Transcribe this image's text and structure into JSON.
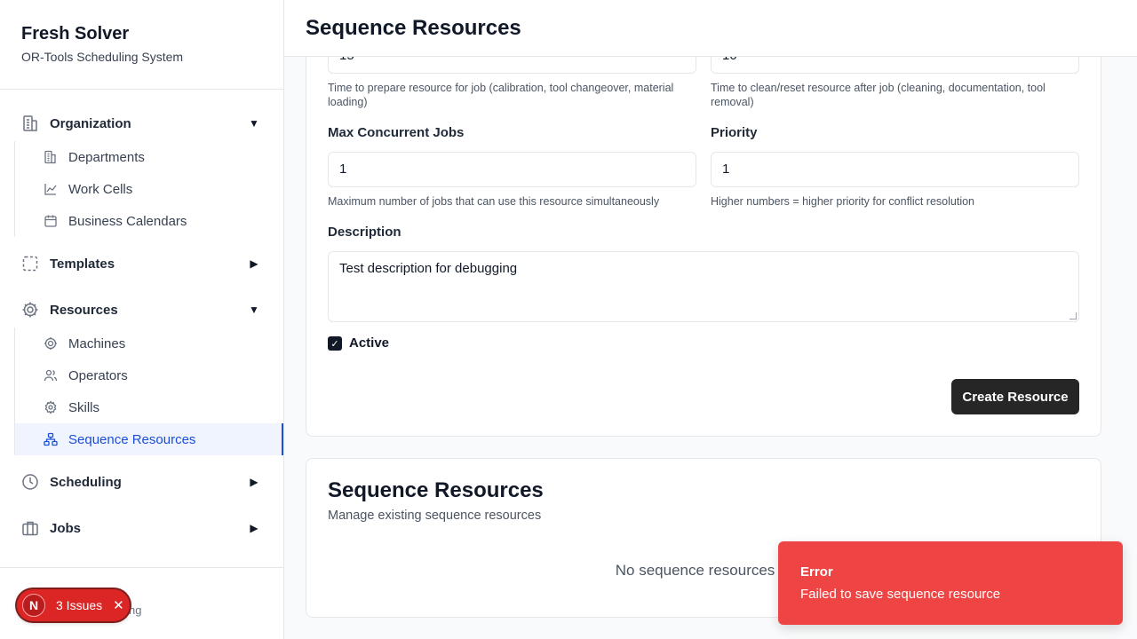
{
  "sidebar": {
    "title": "Fresh Solver",
    "subtitle": "OR-Tools Scheduling System",
    "groups": [
      {
        "label": "Organization",
        "icon": "building-icon",
        "expanded": true,
        "items": [
          {
            "label": "Departments",
            "icon": "building-icon"
          },
          {
            "label": "Work Cells",
            "icon": "chart-icon"
          },
          {
            "label": "Business Calendars",
            "icon": "calendar-icon"
          }
        ]
      },
      {
        "label": "Templates",
        "icon": "dashed-square-icon",
        "expanded": false
      },
      {
        "label": "Resources",
        "icon": "cog-icon",
        "expanded": true,
        "items": [
          {
            "label": "Machines",
            "icon": "cog-icon"
          },
          {
            "label": "Operators",
            "icon": "users-icon"
          },
          {
            "label": "Skills",
            "icon": "gear-icon"
          },
          {
            "label": "Sequence Resources",
            "icon": "network-icon",
            "active": true
          }
        ]
      },
      {
        "label": "Scheduling",
        "icon": "clock-icon",
        "expanded": false
      },
      {
        "label": "Jobs",
        "icon": "briefcase-icon",
        "expanded": false
      }
    ],
    "footer_text": "uling"
  },
  "issues": {
    "badge": "N",
    "label": "3 Issues"
  },
  "header": {
    "title": "Sequence Resources"
  },
  "form": {
    "setup_value": "15",
    "teardown_value": "10",
    "setup_hint": "Time to prepare resource for job (calibration, tool changeover, material loading)",
    "teardown_hint": "Time to clean/reset resource after job (cleaning, documentation, tool removal)",
    "max_jobs_label": "Max Concurrent Jobs",
    "max_jobs_value": "1",
    "max_jobs_hint": "Maximum number of jobs that can use this resource simultaneously",
    "priority_label": "Priority",
    "priority_value": "1",
    "priority_hint": "Higher numbers = higher priority for conflict resolution",
    "description_label": "Description",
    "description_value": "Test description for debugging",
    "active_label": "Active",
    "active_checked": true,
    "submit_label": "Create Resource"
  },
  "list": {
    "title": "Sequence Resources",
    "subtitle": "Manage existing sequence resources",
    "empty_text": "No sequence resources fo"
  },
  "toast": {
    "title": "Error",
    "message": "Failed to save sequence resource"
  },
  "colors": {
    "accent": "#1d4ed8",
    "error": "#ef4444",
    "primary_button": "#262626"
  }
}
